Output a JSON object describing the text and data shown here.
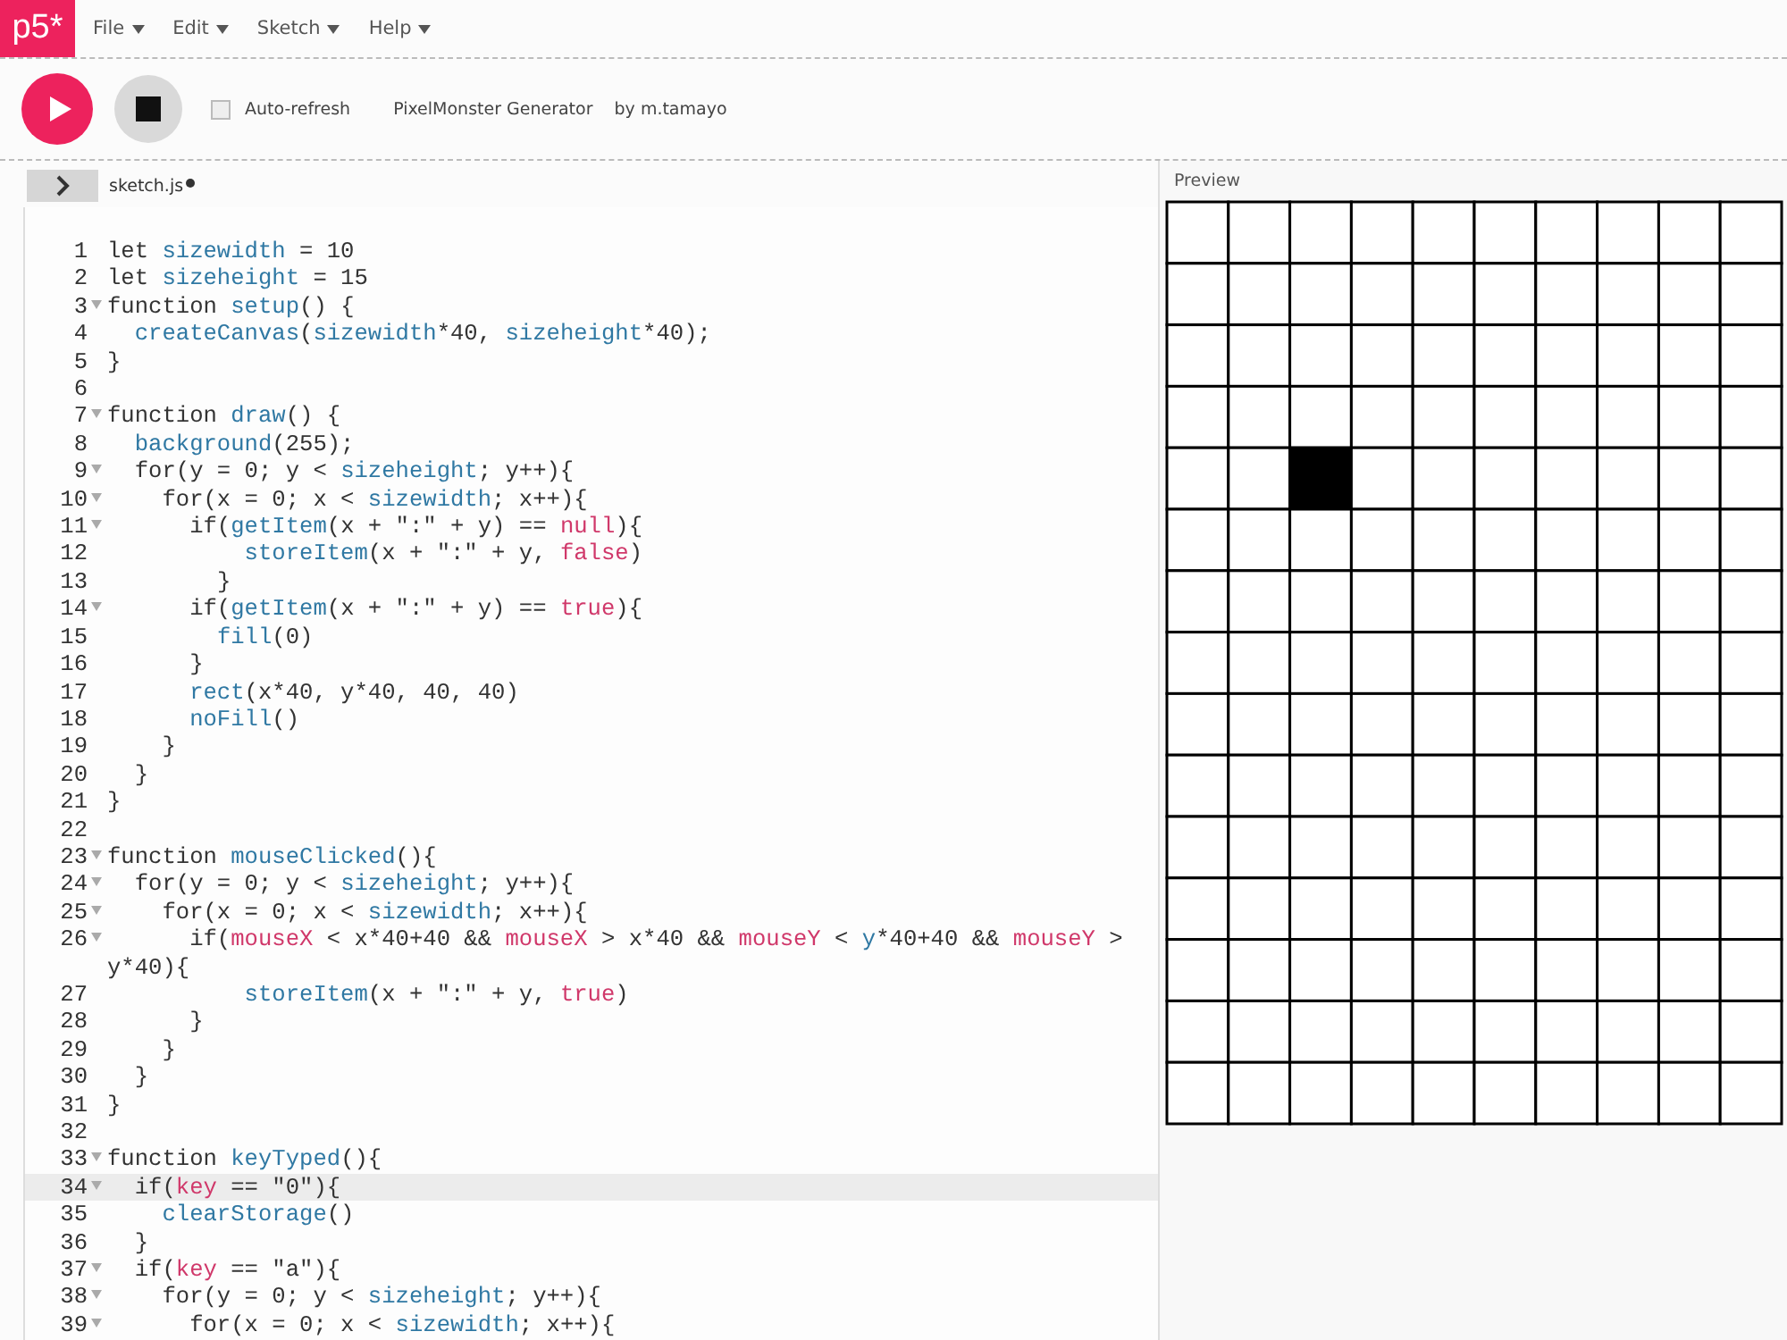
{
  "app": {
    "logo": "p5*"
  },
  "menu": [
    {
      "label": "File"
    },
    {
      "label": "Edit"
    },
    {
      "label": "Sketch"
    },
    {
      "label": "Help"
    }
  ],
  "toolbar": {
    "running": false,
    "auto_refresh": {
      "label": "Auto-refresh",
      "checked": false
    },
    "sketch_name": "PixelMonster Generator",
    "author": "by m.tamayo"
  },
  "editor": {
    "tab": {
      "label": "sketch.js",
      "unsaved": true
    },
    "lines": [
      {
        "number": "1",
        "fold": false,
        "highlighted": false,
        "tokens": [
          {
            "kind": "plain",
            "text": "let "
          },
          {
            "kind": "ident",
            "text": "sizewidth"
          },
          {
            "kind": "plain",
            "text": " = 10"
          }
        ]
      },
      {
        "number": "2",
        "fold": false,
        "highlighted": false,
        "tokens": [
          {
            "kind": "plain",
            "text": "let "
          },
          {
            "kind": "ident",
            "text": "sizeheight"
          },
          {
            "kind": "plain",
            "text": " = 15"
          }
        ]
      },
      {
        "number": "3",
        "fold": true,
        "highlighted": false,
        "tokens": [
          {
            "kind": "plain",
            "text": "function "
          },
          {
            "kind": "ident",
            "text": "setup"
          },
          {
            "kind": "plain",
            "text": "() {"
          }
        ]
      },
      {
        "number": "4",
        "fold": false,
        "highlighted": false,
        "tokens": [
          {
            "kind": "ident",
            "text": "  createCanvas"
          },
          {
            "kind": "plain",
            "text": "("
          },
          {
            "kind": "ident",
            "text": "sizewidth"
          },
          {
            "kind": "plain",
            "text": "*40, "
          },
          {
            "kind": "ident",
            "text": "sizeheight"
          },
          {
            "kind": "plain",
            "text": "*40);"
          }
        ]
      },
      {
        "number": "5",
        "fold": false,
        "highlighted": false,
        "tokens": [
          {
            "kind": "plain",
            "text": "}"
          }
        ]
      },
      {
        "number": "6",
        "fold": false,
        "highlighted": false
      },
      {
        "number": "7",
        "fold": true,
        "highlighted": false,
        "tokens": [
          {
            "kind": "plain",
            "text": "function "
          },
          {
            "kind": "ident",
            "text": "draw"
          },
          {
            "kind": "plain",
            "text": "() {"
          }
        ]
      },
      {
        "number": "8",
        "fold": false,
        "highlighted": false,
        "tokens": [
          {
            "kind": "ident",
            "text": "  background"
          },
          {
            "kind": "plain",
            "text": "(255);"
          }
        ]
      },
      {
        "number": "9",
        "fold": true,
        "highlighted": false,
        "tokens": [
          {
            "kind": "plain",
            "text": "  for(y = 0; y < "
          },
          {
            "kind": "ident",
            "text": "sizeheight"
          },
          {
            "kind": "plain",
            "text": "; y++){"
          }
        ]
      },
      {
        "number": "10",
        "fold": true,
        "highlighted": false,
        "tokens": [
          {
            "kind": "plain",
            "text": "    for(x = 0; x < "
          },
          {
            "kind": "ident",
            "text": "sizewidth"
          },
          {
            "kind": "plain",
            "text": "; x++){"
          }
        ]
      },
      {
        "number": "11",
        "fold": true,
        "highlighted": false,
        "tokens": [
          {
            "kind": "plain",
            "text": "      if("
          },
          {
            "kind": "ident",
            "text": "getItem"
          },
          {
            "kind": "plain",
            "text": "(x + \":\" + y) == "
          },
          {
            "kind": "atom",
            "text": "null"
          },
          {
            "kind": "plain",
            "text": "){"
          }
        ]
      },
      {
        "number": "12",
        "fold": false,
        "highlighted": false,
        "tokens": [
          {
            "kind": "ident",
            "text": "          storeItem"
          },
          {
            "kind": "plain",
            "text": "(x + \":\" + y, "
          },
          {
            "kind": "atom",
            "text": "false"
          },
          {
            "kind": "plain",
            "text": ")"
          }
        ]
      },
      {
        "number": "13",
        "fold": false,
        "highlighted": false,
        "tokens": [
          {
            "kind": "plain",
            "text": "        }"
          }
        ]
      },
      {
        "number": "14",
        "fold": true,
        "highlighted": false,
        "tokens": [
          {
            "kind": "plain",
            "text": "      if("
          },
          {
            "kind": "ident",
            "text": "getItem"
          },
          {
            "kind": "plain",
            "text": "(x + \":\" + y) == "
          },
          {
            "kind": "atom",
            "text": "true"
          },
          {
            "kind": "plain",
            "text": "){"
          }
        ]
      },
      {
        "number": "15",
        "fold": false,
        "highlighted": false,
        "tokens": [
          {
            "kind": "ident",
            "text": "        fill"
          },
          {
            "kind": "plain",
            "text": "(0)"
          }
        ]
      },
      {
        "number": "16",
        "fold": false,
        "highlighted": false,
        "tokens": [
          {
            "kind": "plain",
            "text": "      }"
          }
        ]
      },
      {
        "number": "17",
        "fold": false,
        "highlighted": false,
        "tokens": [
          {
            "kind": "ident",
            "text": "      rect"
          },
          {
            "kind": "plain",
            "text": "(x*40, y*40, 40, 40)"
          }
        ]
      },
      {
        "number": "18",
        "fold": false,
        "highlighted": false,
        "tokens": [
          {
            "kind": "ident",
            "text": "      noFill"
          },
          {
            "kind": "plain",
            "text": "()"
          }
        ]
      },
      {
        "number": "19",
        "fold": false,
        "highlighted": false,
        "tokens": [
          {
            "kind": "plain",
            "text": "    }"
          }
        ]
      },
      {
        "number": "20",
        "fold": false,
        "highlighted": false,
        "tokens": [
          {
            "kind": "plain",
            "text": "  }"
          }
        ]
      },
      {
        "number": "21",
        "fold": false,
        "highlighted": false,
        "tokens": [
          {
            "kind": "plain",
            "text": "}"
          }
        ]
      },
      {
        "number": "22",
        "fold": false,
        "highlighted": false
      },
      {
        "number": "23",
        "fold": true,
        "highlighted": false,
        "tokens": [
          {
            "kind": "plain",
            "text": "function "
          },
          {
            "kind": "ident",
            "text": "mouseClicked"
          },
          {
            "kind": "plain",
            "text": "(){"
          }
        ]
      },
      {
        "number": "24",
        "fold": true,
        "highlighted": false,
        "tokens": [
          {
            "kind": "plain",
            "text": "  for(y = 0; y < "
          },
          {
            "kind": "ident",
            "text": "sizeheight"
          },
          {
            "kind": "plain",
            "text": "; y++){"
          }
        ]
      },
      {
        "number": "25",
        "fold": true,
        "highlighted": false,
        "tokens": [
          {
            "kind": "plain",
            "text": "    for(x = 0; x < "
          },
          {
            "kind": "ident",
            "text": "sizewidth"
          },
          {
            "kind": "plain",
            "text": "; x++){"
          }
        ]
      },
      {
        "number": "26",
        "fold": true,
        "highlighted": false,
        "tokens": [
          {
            "kind": "plain",
            "text": "      if("
          },
          {
            "kind": "atom",
            "text": "mouseX"
          },
          {
            "kind": "plain",
            "text": " < x*40+40 && "
          },
          {
            "kind": "atom",
            "text": "mouseX"
          },
          {
            "kind": "plain",
            "text": " > x*40 && "
          },
          {
            "kind": "atom",
            "text": "mouseY"
          },
          {
            "kind": "plain",
            "text": " < "
          },
          {
            "kind": "ident",
            "text": "y"
          },
          {
            "kind": "plain",
            "text": "*40+40 && "
          },
          {
            "kind": "atom",
            "text": "mouseY"
          },
          {
            "kind": "plain",
            "text": " > y*40){"
          }
        ]
      },
      {
        "number": "27",
        "fold": false,
        "highlighted": false,
        "tokens": [
          {
            "kind": "ident",
            "text": "          storeItem"
          },
          {
            "kind": "plain",
            "text": "(x + \":\" + y, "
          },
          {
            "kind": "atom",
            "text": "true"
          },
          {
            "kind": "plain",
            "text": ")"
          }
        ]
      },
      {
        "number": "28",
        "fold": false,
        "highlighted": false,
        "tokens": [
          {
            "kind": "plain",
            "text": "      }"
          }
        ]
      },
      {
        "number": "29",
        "fold": false,
        "highlighted": false,
        "tokens": [
          {
            "kind": "plain",
            "text": "    }"
          }
        ]
      },
      {
        "number": "30",
        "fold": false,
        "highlighted": false,
        "tokens": [
          {
            "kind": "plain",
            "text": "  }"
          }
        ]
      },
      {
        "number": "31",
        "fold": false,
        "highlighted": false,
        "tokens": [
          {
            "kind": "plain",
            "text": "}"
          }
        ]
      },
      {
        "number": "32",
        "fold": false,
        "highlighted": false
      },
      {
        "number": "33",
        "fold": true,
        "highlighted": false,
        "tokens": [
          {
            "kind": "plain",
            "text": "function "
          },
          {
            "kind": "ident",
            "text": "keyTyped"
          },
          {
            "kind": "plain",
            "text": "(){"
          }
        ]
      },
      {
        "number": "34",
        "fold": true,
        "highlighted": true,
        "tokens": [
          {
            "kind": "plain",
            "text": "  if("
          },
          {
            "kind": "atom",
            "text": "key"
          },
          {
            "kind": "plain",
            "text": " == \"0\"){"
          }
        ]
      },
      {
        "number": "35",
        "fold": false,
        "highlighted": false,
        "tokens": [
          {
            "kind": "ident",
            "text": "    clearStorage"
          },
          {
            "kind": "plain",
            "text": "()"
          }
        ]
      },
      {
        "number": "36",
        "fold": false,
        "highlighted": false,
        "tokens": [
          {
            "kind": "plain",
            "text": "  }"
          }
        ]
      },
      {
        "number": "37",
        "fold": true,
        "highlighted": false,
        "tokens": [
          {
            "kind": "plain",
            "text": "  if("
          },
          {
            "kind": "atom",
            "text": "key"
          },
          {
            "kind": "plain",
            "text": " == \"a\"){"
          }
        ]
      },
      {
        "number": "38",
        "fold": true,
        "highlighted": false,
        "tokens": [
          {
            "kind": "plain",
            "text": "    for(y = 0; y < "
          },
          {
            "kind": "ident",
            "text": "sizeheight"
          },
          {
            "kind": "plain",
            "text": "; y++){"
          }
        ]
      },
      {
        "number": "39",
        "fold": true,
        "highlighted": false,
        "tokens": [
          {
            "kind": "plain",
            "text": "      for(x = 0; x < "
          },
          {
            "kind": "ident",
            "text": "sizewidth"
          },
          {
            "kind": "plain",
            "text": "; x++){"
          }
        ]
      }
    ]
  },
  "preview": {
    "title": "Preview",
    "rows": [
      [
        false,
        false,
        false,
        false,
        false,
        false,
        false,
        false,
        false,
        false
      ],
      [
        false,
        false,
        false,
        false,
        false,
        false,
        false,
        false,
        false,
        false
      ],
      [
        false,
        false,
        false,
        false,
        false,
        false,
        false,
        false,
        false,
        false
      ],
      [
        false,
        false,
        false,
        false,
        false,
        false,
        false,
        false,
        false,
        false
      ],
      [
        false,
        false,
        true,
        false,
        false,
        false,
        false,
        false,
        false,
        false
      ],
      [
        false,
        false,
        false,
        false,
        false,
        false,
        false,
        false,
        false,
        false
      ],
      [
        false,
        false,
        false,
        false,
        false,
        false,
        false,
        false,
        false,
        false
      ],
      [
        false,
        false,
        false,
        false,
        false,
        false,
        false,
        false,
        false,
        false
      ],
      [
        false,
        false,
        false,
        false,
        false,
        false,
        false,
        false,
        false,
        false
      ],
      [
        false,
        false,
        false,
        false,
        false,
        false,
        false,
        false,
        false,
        false
      ],
      [
        false,
        false,
        false,
        false,
        false,
        false,
        false,
        false,
        false,
        false
      ],
      [
        false,
        false,
        false,
        false,
        false,
        false,
        false,
        false,
        false,
        false
      ],
      [
        false,
        false,
        false,
        false,
        false,
        false,
        false,
        false,
        false,
        false
      ],
      [
        false,
        false,
        false,
        false,
        false,
        false,
        false,
        false,
        false,
        false
      ],
      [
        false,
        false,
        false,
        false,
        false,
        false,
        false,
        false,
        false,
        false
      ]
    ]
  }
}
